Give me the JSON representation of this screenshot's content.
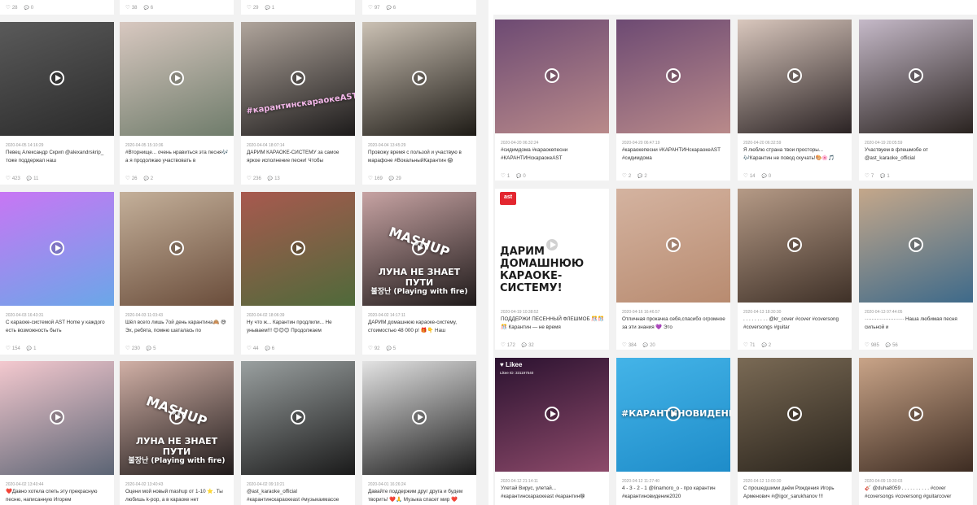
{
  "left_grid": {
    "top_row_stats": [
      {
        "likes": "28",
        "comments": "0"
      },
      {
        "likes": "38",
        "comments": "6"
      },
      {
        "likes": "29",
        "comments": "1"
      },
      {
        "likes": "97",
        "comments": "6"
      }
    ],
    "rows": [
      [
        {
          "date": "2020-04-05 14:16:29",
          "caption": "Певец Александр Скрип @alexandrskrip_ тоже поддержал наш",
          "likes": "423",
          "comments": "11",
          "colors": [
            "#5a5a5a",
            "#2a2a2a"
          ]
        },
        {
          "date": "2020-04-05 15:10:36",
          "caption": "#Вторнище... очень нравиться эта песня🎶 а я продолжаю участвовать в",
          "likes": "26",
          "comments": "2",
          "colors": [
            "#d8c8c0",
            "#6f7c6b"
          ]
        },
        {
          "date": "2020-04-04 18:07:14",
          "caption": "ДАРИМ КАРАОКЕ-СИСТЕМУ за самое яркое исполнение песни! Чтобы",
          "likes": "236",
          "comments": "13",
          "colors": [
            "#b0a59c",
            "#1d1b1b"
          ],
          "overlay": "#карантинскараокеAST"
        },
        {
          "date": "2020-04-04 13:45:29",
          "caption": "Провожу время с пользой и участвую в марафоне #ВокальныйКарантин 😱",
          "likes": "169",
          "comments": "29",
          "colors": [
            "#cbc1b4",
            "#1e1b16"
          ]
        }
      ],
      [
        {
          "date": "2020-04-03 16:43:31",
          "caption": "С караоке-системой AST Home у каждого есть возможность быть",
          "likes": "154",
          "comments": "1",
          "colors": [
            "#c876f4",
            "#6aa7e8"
          ]
        },
        {
          "date": "2020-04-03 11:03:43",
          "caption": "Шёл всего лишь 7ой день карантина🙈 😅 Эх, ребята, помню шаталась по",
          "likes": "230",
          "comments": "5",
          "colors": [
            "#c4b09a",
            "#6a4d3b"
          ]
        },
        {
          "date": "2020-04-02 18:06:39",
          "caption": "Ну что ж... Карантин продлили... Не унываем!!! 😊😊😊 Продолжаем",
          "likes": "44",
          "comments": "6",
          "colors": [
            "#a8594f",
            "#4f6a3a"
          ]
        },
        {
          "date": "2020-04-02 14:17:11",
          "caption": "ДАРИМ домашнюю караоке-систему, стоимостью 48 000 р! 🎁👇 Наш",
          "likes": "92",
          "comments": "5",
          "colors": [
            "#c7a3a3",
            "#1f1a1a"
          ],
          "overlay": "MASHUP\nЛУНА НЕ ЗНАЕТ ПУТИ\n불장난 (Playing with fire)"
        }
      ],
      [
        {
          "date": "2020-04-02 13:40:44",
          "caption": "❤️Давно хотела спеть эту прекрасную песню, написанную Игорем",
          "likes": "",
          "comments": "",
          "colors": [
            "#f4c9cf",
            "#5b6474"
          ]
        },
        {
          "date": "2020-04-02 13:40:43",
          "caption": "Оцени мой новый mashup от 1-10 ⭐. Ты любишь k-pop, а в караоке нет",
          "likes": "",
          "comments": "",
          "colors": [
            "#d1b0a6",
            "#1f1a1a"
          ],
          "overlay": "MASHUP\nЛУНА НЕ ЗНАЕТ ПУТИ\n불장난 (Playing with fire)"
        },
        {
          "date": "2020-04-02 09:10:21",
          "caption": "@ast_karaoke_official #карантинскараокеast #музыкаимасое",
          "likes": "",
          "comments": "",
          "colors": [
            "#9aa0a0",
            "#1a1a1a"
          ]
        },
        {
          "date": "2020-04-01 16:26:24",
          "caption": "Давайте поддержим друг друга и будем творить! ❤️🙏 Музыка спасет мир ❤️",
          "likes": "",
          "comments": "",
          "colors": [
            "#e3e3e3",
            "#1b1b1b"
          ]
        }
      ]
    ]
  },
  "right_grid": {
    "rows": [
      [
        {
          "date": "2020-04-20 06:32:24",
          "caption": "#сидимдома #караокепесни #КАРАНТИНскараокеAST",
          "likes": "1",
          "comments": "0",
          "colors": [
            "#6d4a73",
            "#b98a8a"
          ]
        },
        {
          "date": "2020-04-20 06:47:19",
          "caption": "#караокепесни #КАРАНТИНскараокеAST #сидимдома",
          "likes": "2",
          "comments": "2",
          "colors": [
            "#6d4a73",
            "#b98a8a"
          ]
        },
        {
          "date": "2020-04-20 06:32:59",
          "caption": "Я люблю страна твои просторы... 🎶Карантин не повод скучать!🎨🌸🎵",
          "likes": "14",
          "comments": "0",
          "colors": [
            "#d9c7bd",
            "#2b2324"
          ]
        },
        {
          "date": "2020-04-19 20:05:59",
          "caption": "Участвуем в флешмобе от @ast_karaoke_official",
          "likes": "7",
          "comments": "1",
          "colors": [
            "#c5b9c8",
            "#2a2320"
          ]
        }
      ],
      [
        {
          "date": "2020-04-19 10:38:52",
          "caption": "ПОДДЕРЖИ ПЕСЕННЫЙ ФЛЕШМОБ 🎊🎊🎊 Карантин — не время",
          "likes": "172",
          "comments": "32",
          "colors": [
            "#ffffff",
            "#ffffff"
          ],
          "promo": "ДАРИМ ДОМАШНЮЮ КАРАОКЕ-СИСТЕМУ!",
          "logo": "ast"
        },
        {
          "date": "2020-04-16 16:46:57",
          "caption": "Отличная прокачка себя,спасибо огромное за эти знания 💜 Это",
          "likes": "384",
          "comments": "20",
          "colors": [
            "#d4b3a0",
            "#b88b70"
          ]
        },
        {
          "date": "2020-04-13 18:30:30",
          "caption": ". . . . . . . . . @kr_cover #cover #coversong #coversongs #guitar",
          "likes": "71",
          "comments": "2",
          "colors": [
            "#b59a86",
            "#3f3128"
          ]
        },
        {
          "date": "2020-04-13 07:44:05",
          "caption": "······················· Наша любимая песня сильной и",
          "likes": "985",
          "comments": "56",
          "colors": [
            "#c4a78a",
            "#3e6a8a"
          ]
        }
      ],
      [
        {
          "date": "2020-04-12 21:14:11",
          "caption": "Улетай Вирус, улетай... #карантинскараокеast #карантин😁",
          "likes": "",
          "comments": "",
          "colors": [
            "#2b1230",
            "#8d4a6a"
          ],
          "logo": "likee",
          "likee_label": "Likee",
          "likee_id": "Likee ID: 331197540"
        },
        {
          "date": "2020-04-12 11:27:40",
          "caption": "4 - 3 - 2 - 1 @linamoro_o - про карантин #карантиновидение2020",
          "likes": "",
          "comments": "",
          "colors": [
            "#44b4e8",
            "#1e8cc9"
          ],
          "overlay": "#КАРАНТИНОВИДЕНИЕ"
        },
        {
          "date": "2020-04-12 10:00:30",
          "caption": "С прошедшими днём Рождения Игорь Арменович #@igor_sarukhanov !!!",
          "likes": "",
          "comments": "",
          "colors": [
            "#7a6a55",
            "#2a241c"
          ]
        },
        {
          "date": "2020-04-09 19:30:03",
          "caption": "🎸 @duha8059 . . . . . . . . . . #cover #coversongs #coversong #guitarcover",
          "likes": "",
          "comments": "",
          "colors": [
            "#c9a488",
            "#3d2c22"
          ]
        }
      ]
    ]
  }
}
